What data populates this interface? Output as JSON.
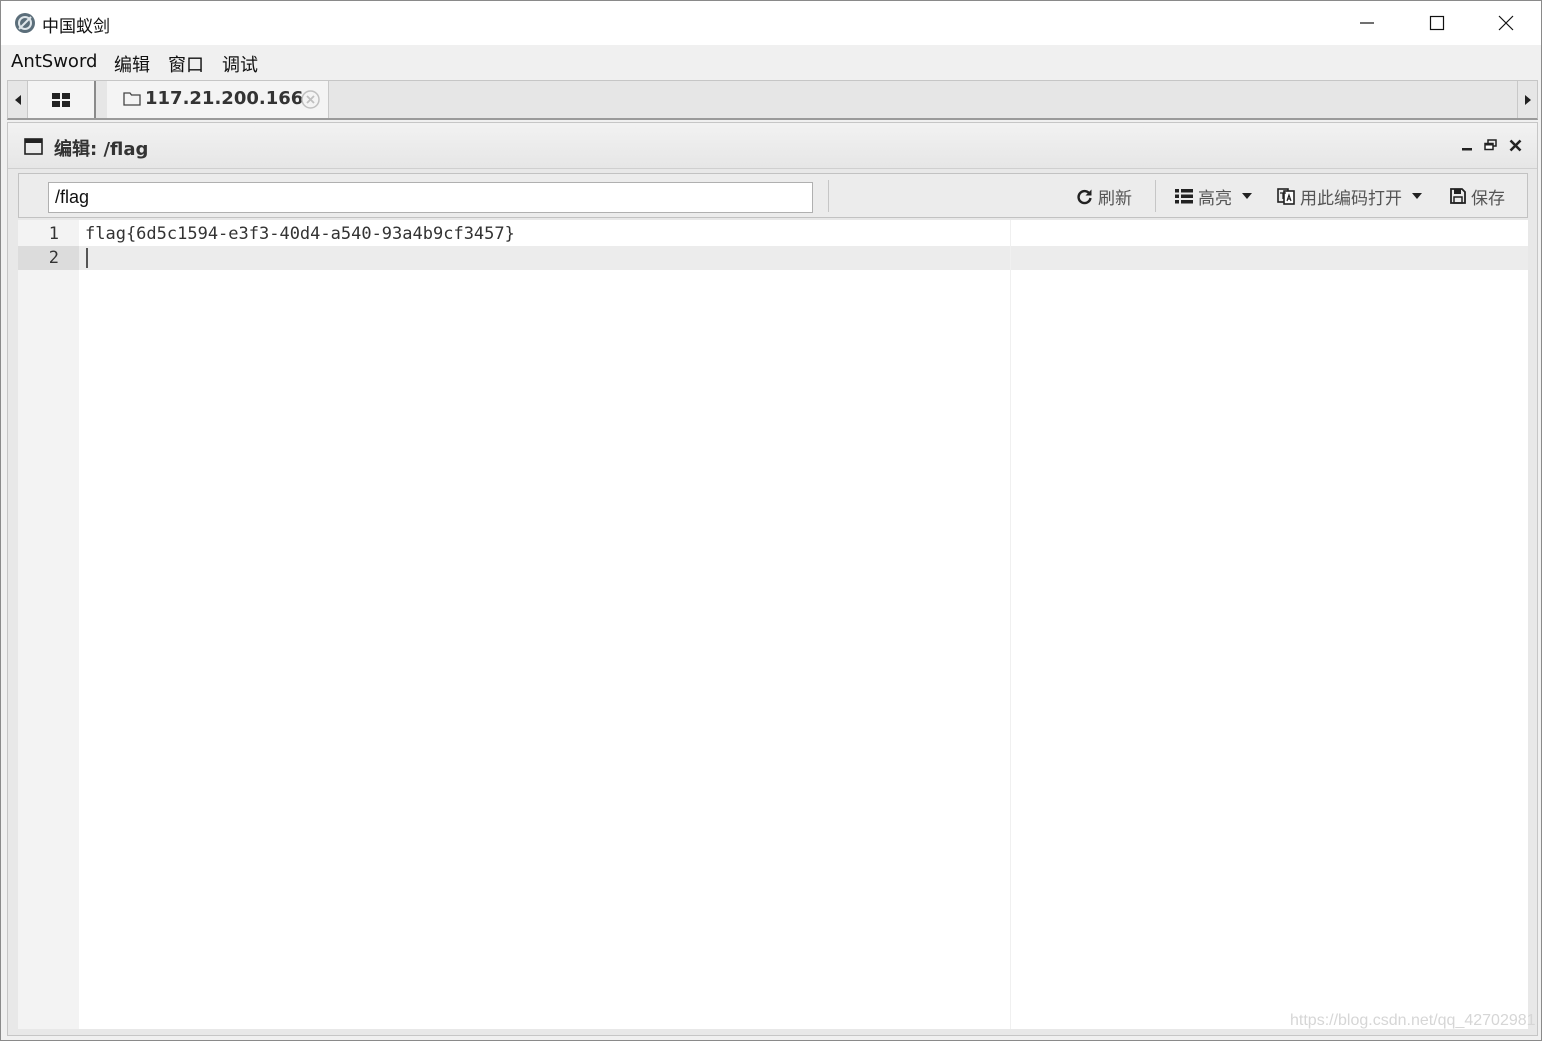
{
  "window": {
    "title": "中国蚁剑",
    "icon": "antsword-logo-icon",
    "controls": [
      "minimize-icon",
      "maximize-icon",
      "close-icon"
    ]
  },
  "menu": {
    "items": [
      "AntSword",
      "编辑",
      "窗口",
      "调试"
    ]
  },
  "tabs": {
    "home_icon": "grid-icon",
    "active_tab": {
      "icon": "folder-icon",
      "label": "117.21.200.166",
      "close_icon": "circle-close-icon"
    }
  },
  "panel": {
    "title": "编辑: /flag",
    "icon": "window-icon",
    "controls": [
      "minimize-icon",
      "restore-icon",
      "close-icon"
    ]
  },
  "toolbar": {
    "path_value": "/flag",
    "refresh_label": "刷新",
    "highlight_label": "高亮",
    "open_with_encoding_label": "用此编码打开",
    "save_label": "保存"
  },
  "editor": {
    "lines": [
      {
        "number": "1",
        "text": "flag{6d5c1594-e3f3-40d4-a540-93a4b9cf3457}"
      },
      {
        "number": "2",
        "text": ""
      }
    ],
    "active_line": 2
  },
  "watermark": "https://blog.csdn.net/qq_42702981"
}
